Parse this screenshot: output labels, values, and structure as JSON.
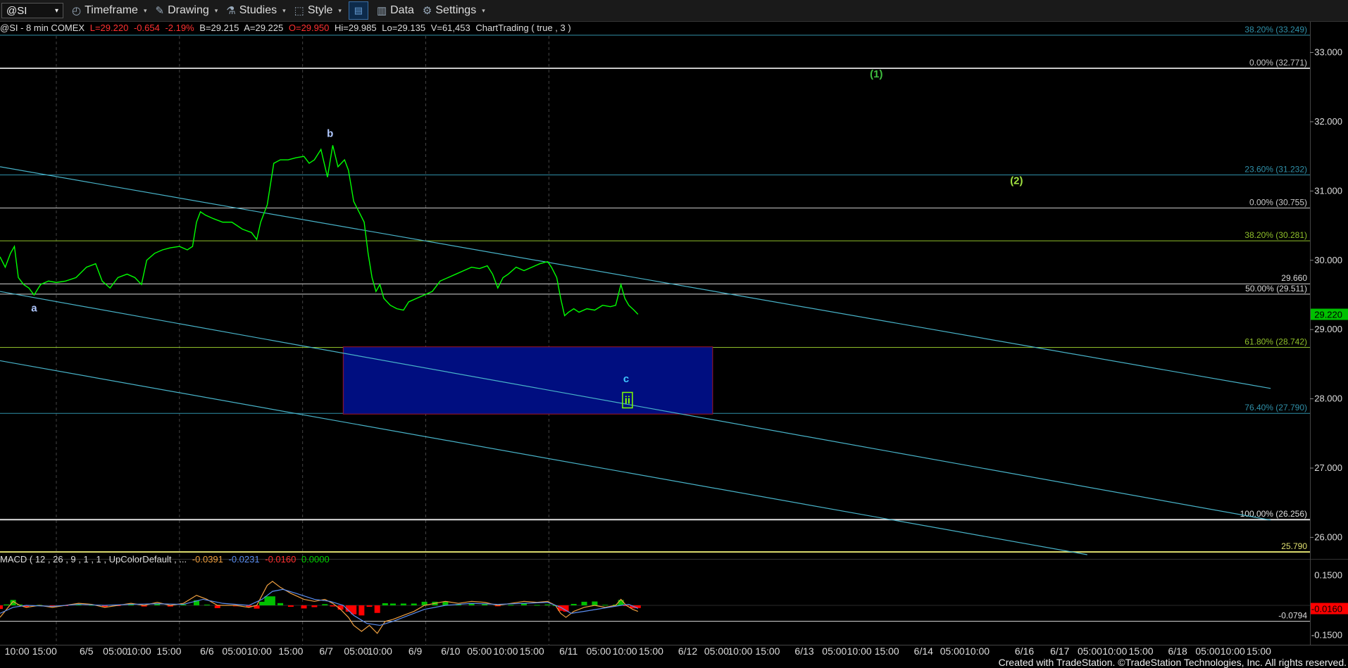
{
  "toolbar": {
    "symbol": "@SI",
    "symbol_caret": "▾",
    "items": [
      {
        "id": "timeframe",
        "label": "Timeframe",
        "icon": "◴",
        "icon_name": "clock-icon"
      },
      {
        "id": "drawing",
        "label": "Drawing",
        "icon": "✎",
        "icon_name": "pencil-icon"
      },
      {
        "id": "studies",
        "label": "Studies",
        "icon": "⚗",
        "icon_name": "flask-icon"
      },
      {
        "id": "style",
        "label": "Style",
        "icon": "⬚",
        "icon_name": "style-icon"
      }
    ],
    "data_label": "Data",
    "data_icon": "▥",
    "settings_label": "Settings",
    "settings_icon": "⚙",
    "caret": "▾"
  },
  "status": {
    "symbol_info": "@SI - 8 min  COMEX",
    "last": "L=29.220",
    "change": "-0.654",
    "change_pct": "-2.19%",
    "bid": "B=29.215",
    "ask": "A=29.225",
    "open": "O=29.950",
    "high": "Hi=29.985",
    "low": "Lo=29.135",
    "volume": "V=61,453",
    "study": "ChartTrading ( true , 3 )"
  },
  "macd": {
    "name": "MACD ( 12 , 26 , 9 , 1 , 1 , UpColorDefault , ...",
    "v1": "-0.0391",
    "v2": "-0.0231",
    "v3": "-0.0160",
    "v4": "0.0000",
    "axis": [
      {
        "label": "0.1500",
        "value": 0.15
      },
      {
        "label": "-0.1500",
        "value": -0.15
      }
    ],
    "current_label": "-0.0160",
    "level_label": "-0.0794",
    "level": -0.0794,
    "ylim": [
      -0.19,
      0.19
    ]
  },
  "footer": "Created with TradeStation. ©TradeStation Technologies, Inc. All rights reserved.",
  "colors": {
    "price": "#00ff00",
    "channel": "#48b3c9",
    "box_fill": "#000e80",
    "box_border": "#a4152b",
    "fib_green": "#8fbf2a",
    "fib_blue": "#2f8fa8",
    "macd_line": "#5b8ef0",
    "signal_line": "#f0a040",
    "hist_pos": "#00c000",
    "hist_neg": "#ff0000",
    "axis_last_bg": "#00c000",
    "axis_macd_bg": "#ff0000"
  },
  "chart_data": {
    "type": "line",
    "title": "",
    "xlabel": "",
    "ylabel": "",
    "ylim": [
      25.75,
      33.3
    ],
    "y_ticks": [
      26,
      27,
      28,
      29,
      30,
      31,
      32,
      33
    ],
    "y_tick_labels": [
      "26.000",
      "27.000",
      "28.000",
      "29.000",
      "30.000",
      "31.000",
      "32.000",
      "33.000"
    ],
    "last_price": 29.22,
    "last_price_label": "29.220",
    "x_tick_labels": [
      {
        "label": "10:00",
        "x": 0.013
      },
      {
        "label": "15:00",
        "x": 0.034
      },
      {
        "label": "6/5",
        "x": 0.066
      },
      {
        "label": "05:00",
        "x": 0.088
      },
      {
        "label": "10:00",
        "x": 0.106
      },
      {
        "label": "15:00",
        "x": 0.129
      },
      {
        "label": "6/6",
        "x": 0.158
      },
      {
        "label": "05:00",
        "x": 0.179
      },
      {
        "label": "10:00",
        "x": 0.198
      },
      {
        "label": "15:00",
        "x": 0.222
      },
      {
        "label": "6/7",
        "x": 0.249
      },
      {
        "label": "05:00",
        "x": 0.272
      },
      {
        "label": "10:00",
        "x": 0.29
      },
      {
        "label": "6/9",
        "x": 0.317
      },
      {
        "label": "6/10",
        "x": 0.344
      },
      {
        "label": "05:00",
        "x": 0.366
      },
      {
        "label": "10:00",
        "x": 0.386
      },
      {
        "label": "15:00",
        "x": 0.406
      },
      {
        "label": "6/11",
        "x": 0.434
      },
      {
        "label": "05:00",
        "x": 0.457
      },
      {
        "label": "10:00",
        "x": 0.477
      },
      {
        "label": "15:00",
        "x": 0.497
      },
      {
        "label": "6/12",
        "x": 0.525
      },
      {
        "label": "05:00",
        "x": 0.547
      },
      {
        "label": "10:00",
        "x": 0.565
      },
      {
        "label": "15:00",
        "x": 0.586
      },
      {
        "label": "6/13",
        "x": 0.614
      },
      {
        "label": "05:00",
        "x": 0.637
      },
      {
        "label": "10:00",
        "x": 0.656
      },
      {
        "label": "15:00",
        "x": 0.677
      },
      {
        "label": "6/14",
        "x": 0.705
      },
      {
        "label": "05:00",
        "x": 0.727
      },
      {
        "label": "10:00",
        "x": 0.746
      },
      {
        "label": "6/16",
        "x": 0.782
      },
      {
        "label": "6/17",
        "x": 0.809
      },
      {
        "label": "05:00",
        "x": 0.832
      },
      {
        "label": "10:00",
        "x": 0.851
      },
      {
        "label": "15:00",
        "x": 0.871
      },
      {
        "label": "6/18",
        "x": 0.899
      },
      {
        "label": "05:00",
        "x": 0.922
      },
      {
        "label": "10:00",
        "x": 0.941
      },
      {
        "label": "15:00",
        "x": 0.961
      }
    ],
    "vertical_separators": [
      0.043,
      0.137,
      0.231,
      0.325,
      0.419
    ],
    "price_path": [
      [
        0.0,
        30.05
      ],
      [
        0.004,
        29.9
      ],
      [
        0.008,
        30.1
      ],
      [
        0.011,
        30.2
      ],
      [
        0.014,
        29.75
      ],
      [
        0.018,
        29.65
      ],
      [
        0.022,
        29.6
      ],
      [
        0.026,
        29.5
      ],
      [
        0.031,
        29.65
      ],
      [
        0.037,
        29.7
      ],
      [
        0.043,
        29.68
      ],
      [
        0.05,
        29.7
      ],
      [
        0.058,
        29.75
      ],
      [
        0.066,
        29.9
      ],
      [
        0.073,
        29.95
      ],
      [
        0.078,
        29.7
      ],
      [
        0.084,
        29.6
      ],
      [
        0.09,
        29.75
      ],
      [
        0.097,
        29.8
      ],
      [
        0.103,
        29.75
      ],
      [
        0.108,
        29.65
      ],
      [
        0.112,
        30.0
      ],
      [
        0.118,
        30.1
      ],
      [
        0.124,
        30.15
      ],
      [
        0.13,
        30.18
      ],
      [
        0.137,
        30.2
      ],
      [
        0.143,
        30.15
      ],
      [
        0.147,
        30.2
      ],
      [
        0.15,
        30.55
      ],
      [
        0.153,
        30.7
      ],
      [
        0.157,
        30.65
      ],
      [
        0.163,
        30.6
      ],
      [
        0.17,
        30.55
      ],
      [
        0.177,
        30.55
      ],
      [
        0.185,
        30.45
      ],
      [
        0.192,
        30.4
      ],
      [
        0.196,
        30.3
      ],
      [
        0.199,
        30.55
      ],
      [
        0.204,
        30.8
      ],
      [
        0.209,
        31.4
      ],
      [
        0.214,
        31.45
      ],
      [
        0.22,
        31.45
      ],
      [
        0.226,
        31.48
      ],
      [
        0.232,
        31.5
      ],
      [
        0.236,
        31.4
      ],
      [
        0.24,
        31.45
      ],
      [
        0.245,
        31.6
      ],
      [
        0.25,
        31.2
      ],
      [
        0.254,
        31.66
      ],
      [
        0.258,
        31.35
      ],
      [
        0.263,
        31.45
      ],
      [
        0.266,
        31.3
      ],
      [
        0.27,
        30.85
      ],
      [
        0.274,
        30.7
      ],
      [
        0.278,
        30.55
      ],
      [
        0.281,
        30.1
      ],
      [
        0.284,
        29.75
      ],
      [
        0.287,
        29.55
      ],
      [
        0.29,
        29.65
      ],
      [
        0.293,
        29.45
      ],
      [
        0.298,
        29.35
      ],
      [
        0.303,
        29.3
      ],
      [
        0.308,
        29.28
      ],
      [
        0.312,
        29.4
      ],
      [
        0.318,
        29.45
      ],
      [
        0.324,
        29.5
      ],
      [
        0.33,
        29.55
      ],
      [
        0.336,
        29.7
      ],
      [
        0.342,
        29.75
      ],
      [
        0.348,
        29.8
      ],
      [
        0.354,
        29.85
      ],
      [
        0.36,
        29.9
      ],
      [
        0.366,
        29.88
      ],
      [
        0.372,
        29.92
      ],
      [
        0.376,
        29.8
      ],
      [
        0.38,
        29.6
      ],
      [
        0.384,
        29.75
      ],
      [
        0.388,
        29.8
      ],
      [
        0.394,
        29.9
      ],
      [
        0.4,
        29.85
      ],
      [
        0.406,
        29.9
      ],
      [
        0.412,
        29.95
      ],
      [
        0.418,
        29.98
      ],
      [
        0.421,
        29.9
      ],
      [
        0.425,
        29.75
      ],
      [
        0.428,
        29.45
      ],
      [
        0.431,
        29.2
      ],
      [
        0.434,
        29.25
      ],
      [
        0.438,
        29.3
      ],
      [
        0.442,
        29.25
      ],
      [
        0.448,
        29.3
      ],
      [
        0.454,
        29.28
      ],
      [
        0.46,
        29.35
      ],
      [
        0.466,
        29.33
      ],
      [
        0.47,
        29.35
      ],
      [
        0.474,
        29.65
      ],
      [
        0.477,
        29.45
      ],
      [
        0.48,
        29.35
      ],
      [
        0.484,
        29.28
      ],
      [
        0.487,
        29.22
      ]
    ],
    "horizontal_lines": [
      {
        "y": 33.249,
        "color": "#2f8fa8",
        "label": "38.20% (33.249)",
        "label_color": "#2f8fa8"
      },
      {
        "y": 32.771,
        "color": "#c8c8c8",
        "label": "0.00% (32.771)",
        "label_color": "#c8c8c8"
      },
      {
        "y": 31.232,
        "color": "#2f8fa8",
        "label": "23.60% (31.232)",
        "label_color": "#2f8fa8"
      },
      {
        "y": 30.755,
        "color": "#c8c8c8",
        "label": "0.00% (30.755)",
        "label_color": "#c8c8c8"
      },
      {
        "y": 30.281,
        "color": "#8fbf2a",
        "label": "38.20% (30.281)",
        "label_color": "#8fbf2a"
      },
      {
        "y": 29.66,
        "color": "#d8d8d8",
        "label": "29.660",
        "label_color": "#d8d8d8"
      },
      {
        "y": 29.511,
        "color": "#d8d8d8",
        "label": "50.00% (29.511)",
        "label_color": "#d8d8d8"
      },
      {
        "y": 28.742,
        "color": "#8fbf2a",
        "label": "61.80% (28.742)",
        "label_color": "#8fbf2a"
      },
      {
        "y": 27.79,
        "color": "#2f8fa8",
        "label": "76.40% (27.790)",
        "label_color": "#2f8fa8"
      },
      {
        "y": 26.256,
        "color": "#e0e0e0",
        "label": "100.00% (26.256)",
        "label_color": "#e0e0e0"
      },
      {
        "y": 25.79,
        "color": "#e0e070",
        "label": "25.790",
        "label_color": "#e0e070"
      }
    ],
    "trendlines": [
      {
        "points": [
          [
            0.0,
            31.35
          ],
          [
            0.97,
            28.15
          ]
        ],
        "color": "#48b3c9"
      },
      {
        "points": [
          [
            0.0,
            29.55
          ],
          [
            0.97,
            26.25
          ]
        ],
        "color": "#48b3c9"
      },
      {
        "points": [
          [
            0.0,
            28.55
          ],
          [
            0.83,
            25.75
          ]
        ],
        "color": "#48b3c9"
      }
    ],
    "target_box": {
      "x0": 0.262,
      "x1": 0.544,
      "y0": 27.78,
      "y1": 28.75
    },
    "labels": [
      {
        "text": "a",
        "x": 0.026,
        "y": 29.26,
        "color": "#b0c8ff"
      },
      {
        "text": "b",
        "x": 0.252,
        "y": 31.78,
        "color": "#b0c8ff"
      },
      {
        "text": "c",
        "x": 0.478,
        "y": 28.24,
        "color": "#40c8ff"
      },
      {
        "text": "ii",
        "x": 0.479,
        "y": 27.93,
        "color": "#7fff00"
      },
      {
        "text": "(1)",
        "x": 0.669,
        "y": 32.64,
        "color": "#40c040"
      },
      {
        "text": "(2)",
        "x": 0.776,
        "y": 31.1,
        "color": "#a0e040"
      }
    ],
    "macd_line": [
      [
        0.0,
        -0.06
      ],
      [
        0.005,
        -0.02
      ],
      [
        0.01,
        0.02
      ],
      [
        0.015,
        0.0
      ],
      [
        0.02,
        -0.01
      ],
      [
        0.03,
        0.0
      ],
      [
        0.04,
        -0.01
      ],
      [
        0.05,
        0.0
      ],
      [
        0.06,
        0.01
      ],
      [
        0.07,
        0.005
      ],
      [
        0.08,
        -0.01
      ],
      [
        0.09,
        0.0
      ],
      [
        0.1,
        0.01
      ],
      [
        0.11,
        0.0
      ],
      [
        0.12,
        0.015
      ],
      [
        0.13,
        0.0
      ],
      [
        0.14,
        0.01
      ],
      [
        0.15,
        0.05
      ],
      [
        0.158,
        0.03
      ],
      [
        0.166,
        0.0
      ],
      [
        0.18,
        0.0
      ],
      [
        0.19,
        -0.01
      ],
      [
        0.196,
        0.0
      ],
      [
        0.2,
        0.05
      ],
      [
        0.204,
        0.1
      ],
      [
        0.208,
        0.12
      ],
      [
        0.214,
        0.09
      ],
      [
        0.222,
        0.06
      ],
      [
        0.232,
        0.03
      ],
      [
        0.24,
        0.02
      ],
      [
        0.248,
        0.03
      ],
      [
        0.254,
        0.01
      ],
      [
        0.26,
        -0.02
      ],
      [
        0.266,
        -0.06
      ],
      [
        0.27,
        -0.1
      ],
      [
        0.276,
        -0.13
      ],
      [
        0.282,
        -0.1
      ],
      [
        0.288,
        -0.14
      ],
      [
        0.294,
        -0.08
      ],
      [
        0.3,
        -0.07
      ],
      [
        0.308,
        -0.05
      ],
      [
        0.316,
        -0.03
      ],
      [
        0.324,
        0.0
      ],
      [
        0.332,
        0.01
      ],
      [
        0.34,
        0.02
      ],
      [
        0.35,
        0.01
      ],
      [
        0.36,
        0.02
      ],
      [
        0.37,
        0.015
      ],
      [
        0.38,
        0.0
      ],
      [
        0.39,
        0.01
      ],
      [
        0.4,
        0.02
      ],
      [
        0.41,
        0.015
      ],
      [
        0.418,
        0.02
      ],
      [
        0.424,
        0.0
      ],
      [
        0.428,
        -0.04
      ],
      [
        0.432,
        -0.06
      ],
      [
        0.438,
        -0.03
      ],
      [
        0.446,
        -0.01
      ],
      [
        0.454,
        0.0
      ],
      [
        0.462,
        -0.01
      ],
      [
        0.47,
        0.0
      ],
      [
        0.474,
        0.03
      ],
      [
        0.478,
        0.0
      ],
      [
        0.483,
        -0.02
      ],
      [
        0.487,
        -0.03
      ]
    ],
    "signal_line": [
      [
        0.0,
        -0.04
      ],
      [
        0.01,
        -0.01
      ],
      [
        0.02,
        0.0
      ],
      [
        0.04,
        -0.005
      ],
      [
        0.06,
        0.005
      ],
      [
        0.08,
        0.0
      ],
      [
        0.1,
        0.005
      ],
      [
        0.12,
        0.008
      ],
      [
        0.14,
        0.005
      ],
      [
        0.155,
        0.03
      ],
      [
        0.17,
        0.01
      ],
      [
        0.19,
        0.0
      ],
      [
        0.2,
        0.03
      ],
      [
        0.208,
        0.07
      ],
      [
        0.216,
        0.08
      ],
      [
        0.226,
        0.06
      ],
      [
        0.24,
        0.03
      ],
      [
        0.252,
        0.02
      ],
      [
        0.262,
        0.0
      ],
      [
        0.27,
        -0.05
      ],
      [
        0.28,
        -0.09
      ],
      [
        0.29,
        -0.1
      ],
      [
        0.3,
        -0.08
      ],
      [
        0.312,
        -0.05
      ],
      [
        0.324,
        -0.02
      ],
      [
        0.34,
        0.0
      ],
      [
        0.36,
        0.01
      ],
      [
        0.38,
        0.005
      ],
      [
        0.4,
        0.01
      ],
      [
        0.418,
        0.015
      ],
      [
        0.428,
        -0.01
      ],
      [
        0.436,
        -0.04
      ],
      [
        0.446,
        -0.03
      ],
      [
        0.46,
        -0.015
      ],
      [
        0.474,
        0.0
      ],
      [
        0.48,
        0.005
      ],
      [
        0.487,
        -0.015
      ]
    ]
  }
}
